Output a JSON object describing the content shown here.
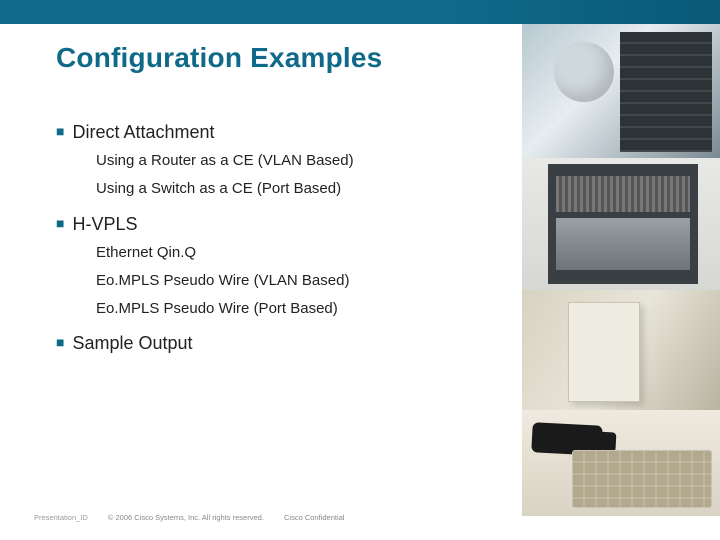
{
  "title": "Configuration Examples",
  "sections": [
    {
      "heading": "Direct Attachment",
      "items": [
        "Using a Router as a CE (VLAN Based)",
        "Using a Switch as a CE (Port Based)"
      ]
    },
    {
      "heading": "H-VPLS",
      "items": [
        "Ethernet Qin.Q",
        "Eo.MPLS Pseudo Wire (VLAN Based)",
        "Eo.MPLS Pseudo Wire (Port Based)"
      ]
    },
    {
      "heading": "Sample Output",
      "items": []
    }
  ],
  "footer": {
    "id": "Presentation_ID",
    "copyright": "© 2006 Cisco Systems, Inc. All rights reserved.",
    "confidential": "Cisco Confidential"
  }
}
